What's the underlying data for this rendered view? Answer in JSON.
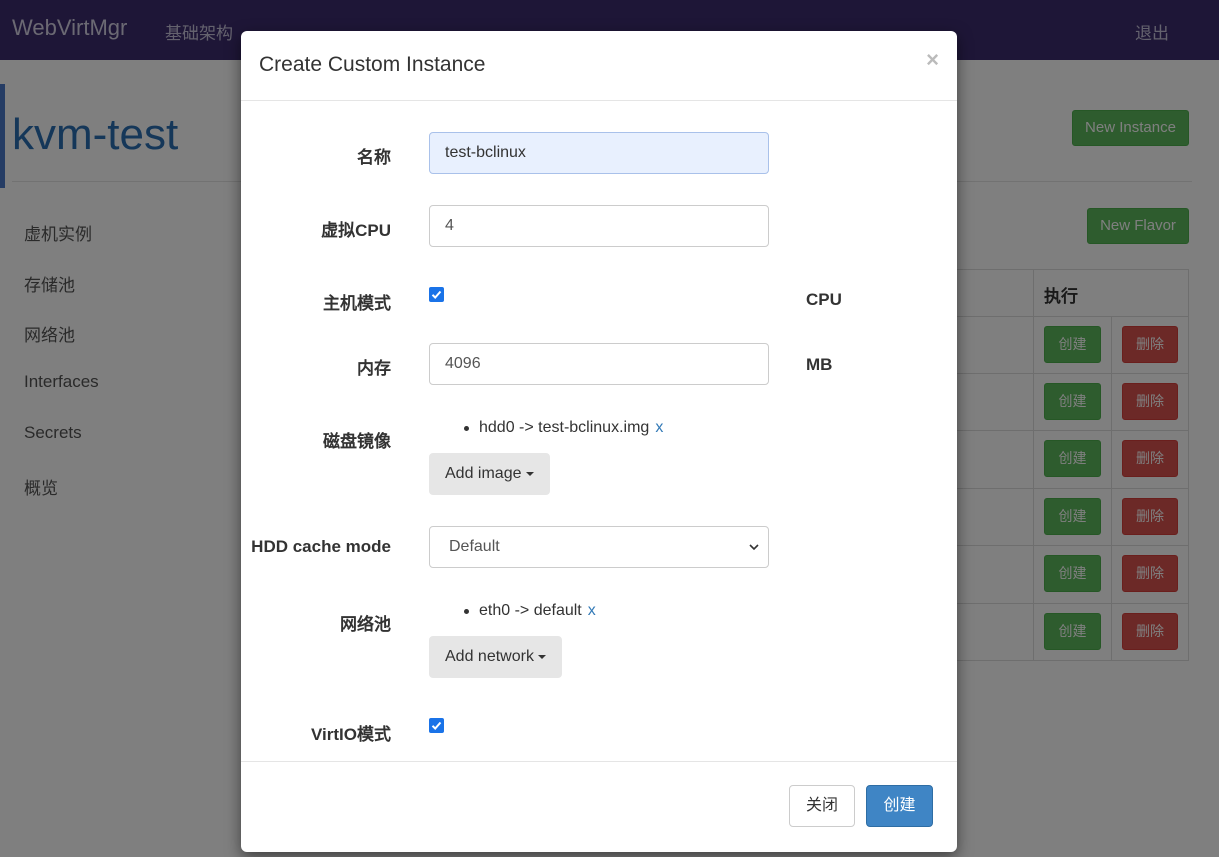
{
  "navbar": {
    "brand": "WebVirtMgr",
    "infrastructure": "基础架构",
    "logout": "退出"
  },
  "page": {
    "title": "kvm-test",
    "new_instance": "New Instance",
    "new_flavor": "New Flavor"
  },
  "sidebar": {
    "items": [
      {
        "label": "虚机实例"
      },
      {
        "label": "存储池"
      },
      {
        "label": "网络池"
      },
      {
        "label": "Interfaces"
      },
      {
        "label": "Secrets"
      },
      {
        "label": "概览"
      }
    ]
  },
  "table": {
    "header_action": "执行",
    "rows": [
      {
        "create": "创建",
        "delete": "删除"
      },
      {
        "create": "创建",
        "delete": "删除"
      },
      {
        "create": "创建",
        "delete": "删除"
      },
      {
        "create": "创建",
        "delete": "删除"
      },
      {
        "create": "创建",
        "delete": "删除"
      },
      {
        "create": "创建",
        "delete": "删除"
      }
    ]
  },
  "modal": {
    "title": "Create Custom Instance",
    "close_symbol": "×",
    "fields": {
      "name": {
        "label": "名称",
        "value": "test-bclinux"
      },
      "vcpu": {
        "label": "虚拟CPU",
        "value": "4"
      },
      "host_model": {
        "label": "主机模式",
        "checked": true,
        "unit": "CPU"
      },
      "memory": {
        "label": "内存",
        "value": "4096",
        "unit": "MB"
      },
      "disk_images": {
        "label": "磁盘镜像",
        "items": [
          {
            "text": "hdd0 -> test-bclinux.img",
            "remove": "x"
          }
        ],
        "add_button": "Add image"
      },
      "hdd_cache_mode": {
        "label": "HDD cache mode",
        "selected": "Default"
      },
      "networks": {
        "label": "网络池",
        "items": [
          {
            "text": "eth0 -> default",
            "remove": "x"
          }
        ],
        "add_button": "Add network"
      },
      "virtio": {
        "label": "VirtIO模式",
        "checked": true
      }
    },
    "footer": {
      "close": "关闭",
      "create": "创建"
    }
  }
}
